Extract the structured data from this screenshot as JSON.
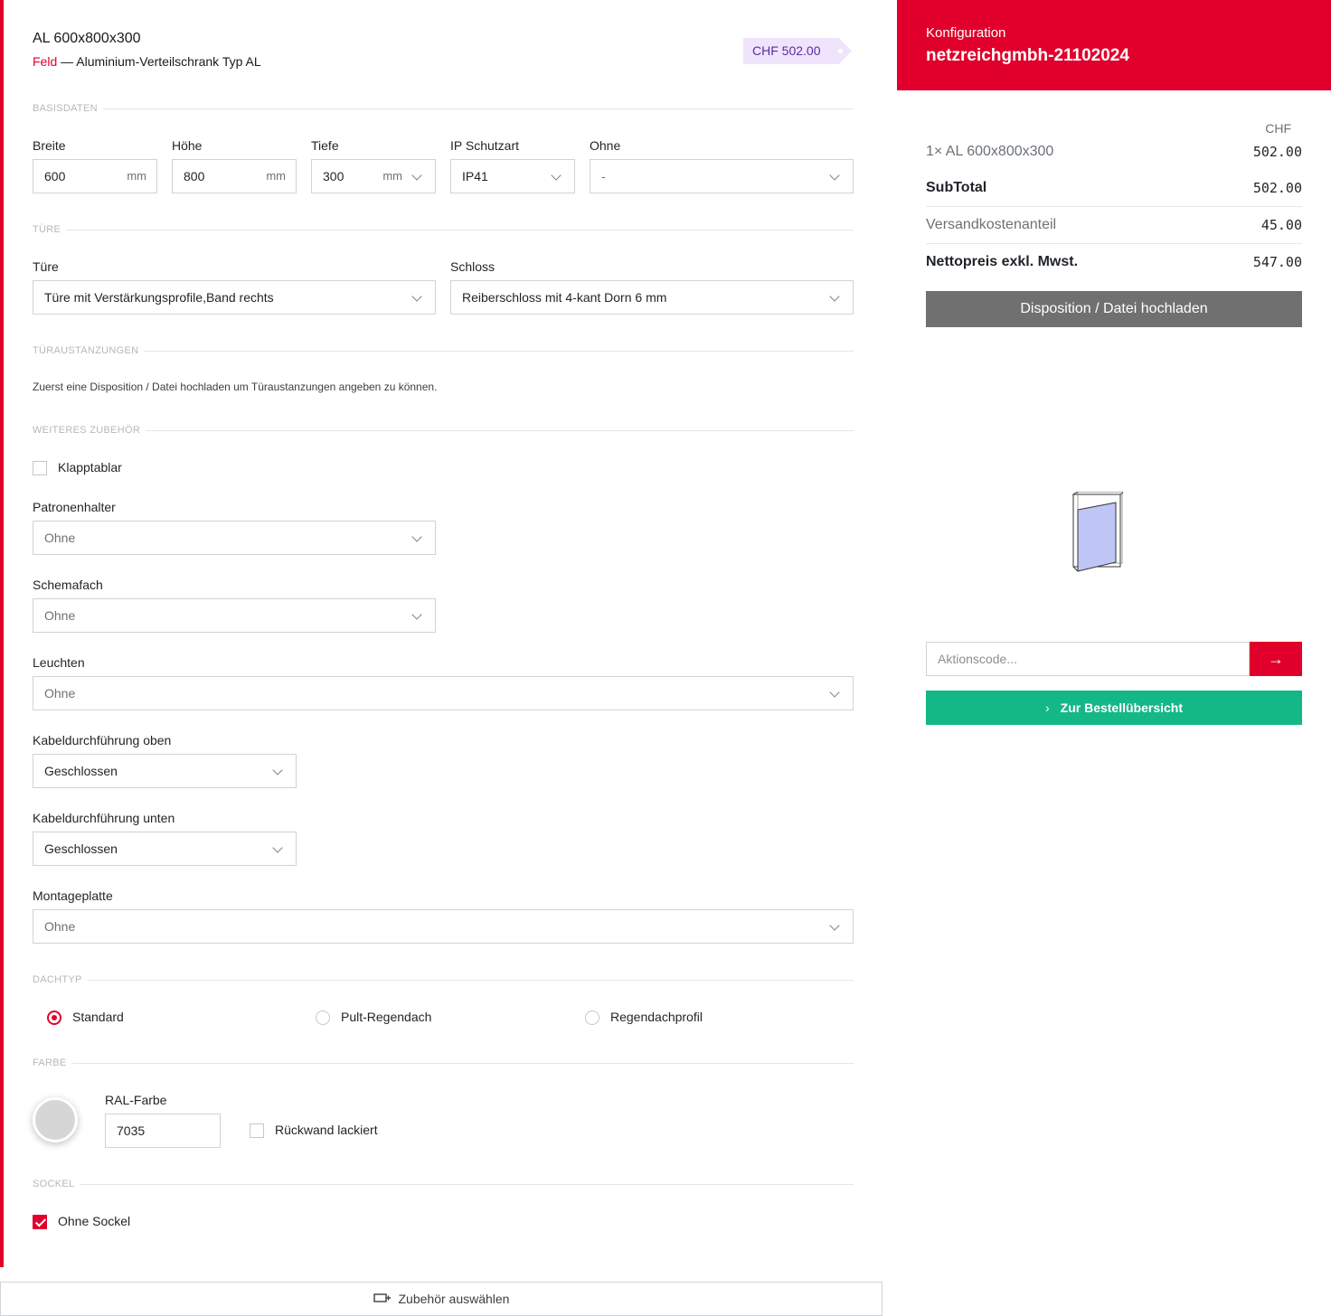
{
  "header": {
    "title": "AL 600x800x300",
    "subtitle_prefix": "Feld",
    "subtitle_rest": " — Aluminium-Verteilschrank Typ AL",
    "price_badge": "CHF 502.00"
  },
  "sections": {
    "basisdaten": "BASISDATEN",
    "tuere": "TÜRE",
    "tueraustanzungen": "TÜRAUSTANZUNGEN",
    "zubehoer": "WEITERES ZUBEHÖR",
    "dachtyp": "DACHTYP",
    "farbe": "FARBE",
    "sockel": "SOCKEL"
  },
  "basis": {
    "breite_label": "Breite",
    "breite_value": "600",
    "breite_unit": "mm",
    "hoehe_label": "Höhe",
    "hoehe_value": "800",
    "hoehe_unit": "mm",
    "tiefe_label": "Tiefe",
    "tiefe_value": "300",
    "tiefe_unit": "mm",
    "ip_label": "IP Schutzart",
    "ip_value": "IP41",
    "ohne_label": "Ohne",
    "ohne_value": "-"
  },
  "tuere": {
    "tuere_label": "Türe",
    "tuere_value": "Türe mit Verstärkungsprofile,Band rechts",
    "schloss_label": "Schloss",
    "schloss_value": "Reiberschloss mit 4-kant Dorn 6 mm"
  },
  "austanzungen_note": "Zuerst eine Disposition / Datei hochladen um Türaustanzungen angeben zu können.",
  "zubehoer": {
    "klapptablar_label": "Klapptablar",
    "klapptablar_checked": false,
    "patronenhalter_label": "Patronenhalter",
    "patronenhalter_value": "Ohne",
    "schemafach_label": "Schemafach",
    "schemafach_value": "Ohne",
    "leuchten_label": "Leuchten",
    "leuchten_value": "Ohne",
    "kabel_oben_label": "Kabeldurchführung oben",
    "kabel_oben_value": "Geschlossen",
    "kabel_unten_label": "Kabeldurchführung unten",
    "kabel_unten_value": "Geschlossen",
    "montageplatte_label": "Montageplatte",
    "montageplatte_value": "Ohne"
  },
  "dachtyp": {
    "options": [
      "Standard",
      "Pult-Regendach",
      "Regendachprofil"
    ],
    "selected": "Standard"
  },
  "farbe": {
    "ral_label": "RAL-Farbe",
    "ral_value": "7035",
    "swatch_color": "#d6d6d6",
    "rueckwand_label": "Rückwand lackiert",
    "rueckwand_checked": false
  },
  "sockel": {
    "ohne_sockel_label": "Ohne Sockel",
    "ohne_sockel_checked": true
  },
  "footer": {
    "zubehoer_button": "Zubehör auswählen"
  },
  "sidebar": {
    "heading_small": "Konfiguration",
    "heading_big": "netzreichgmbh-21102024",
    "currency": "CHF",
    "line_item": "1× AL 600x800x300",
    "line_item_price": "502.00",
    "subtotal_label": "SubTotal",
    "subtotal_value": "502.00",
    "versand_label": "Versandkostenanteil",
    "versand_value": "45.00",
    "netto_label": "Nettopreis exkl. Mwst.",
    "netto_value": "547.00",
    "upload_button": "Disposition / Datei hochladen",
    "code_placeholder": "Aktionscode...",
    "order_button": "Zur Bestellübersicht"
  },
  "colors": {
    "accent": "#e0002b",
    "success": "#13b886",
    "badge_bg": "#efe4fb",
    "badge_text": "#5b2a9e",
    "upload_bg": "#707070"
  }
}
